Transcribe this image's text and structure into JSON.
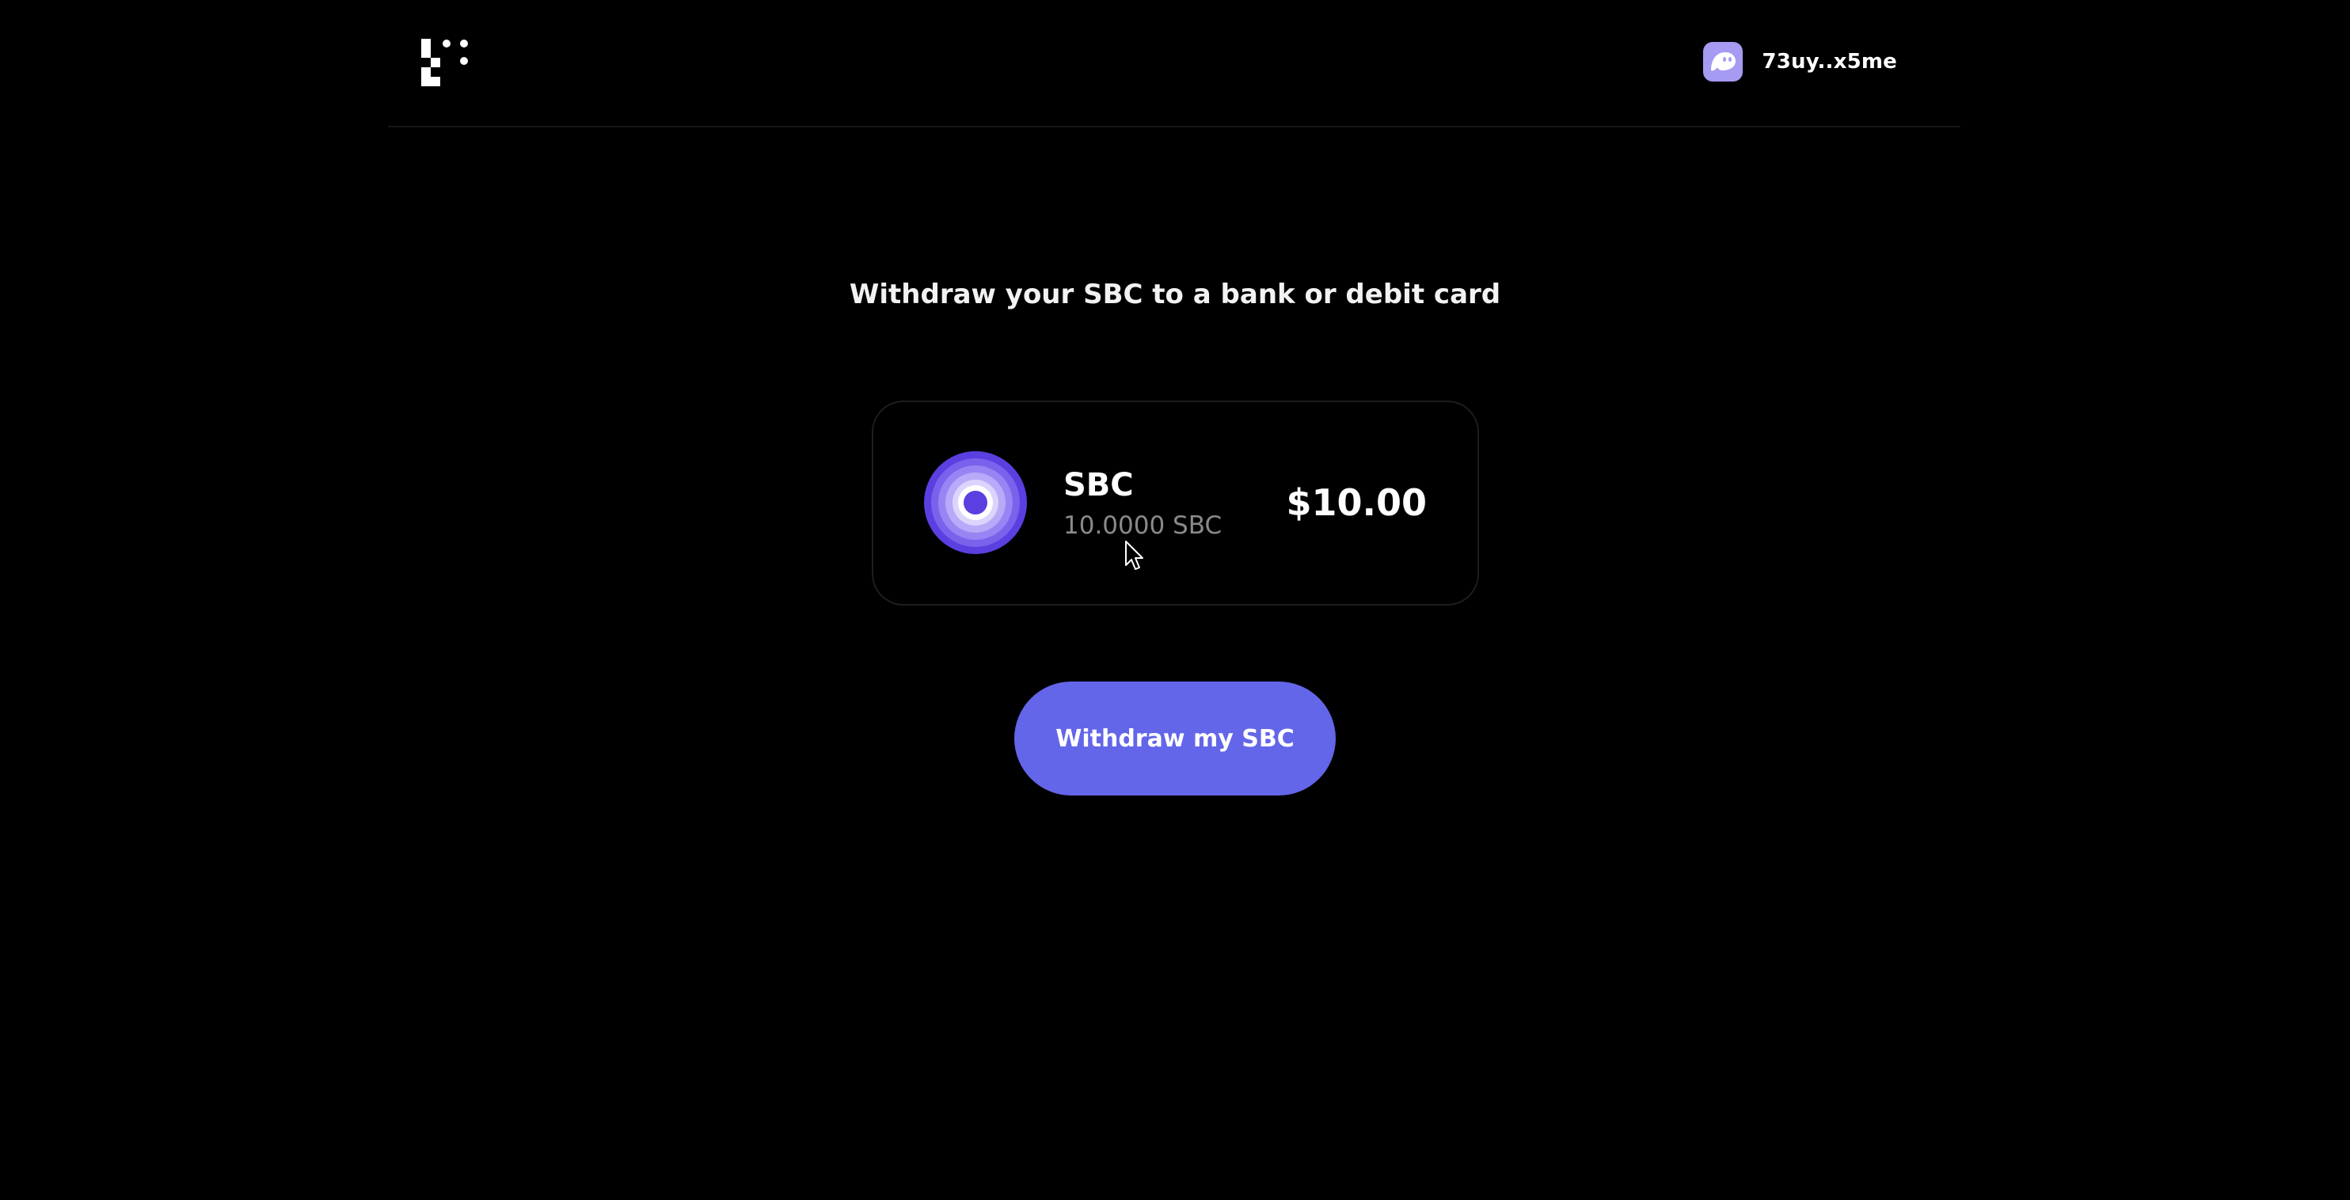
{
  "header": {
    "logo_icon": "pixel-logo-icon",
    "wallet": {
      "avatar_icon": "ghost-icon",
      "avatar_color": "#a59bf3",
      "address": "73uy..x5me"
    }
  },
  "main": {
    "headline": "Withdraw your SBC to a bank or debit card",
    "token": {
      "icon": "concentric-circles-token-icon",
      "name": "SBC",
      "balance": "10.0000 SBC",
      "value": "$10.00"
    },
    "withdraw_button_label": "Withdraw my SBC"
  },
  "colors": {
    "background": "#000000",
    "accent": "#6366e9",
    "muted_text": "#8a8a8a"
  }
}
